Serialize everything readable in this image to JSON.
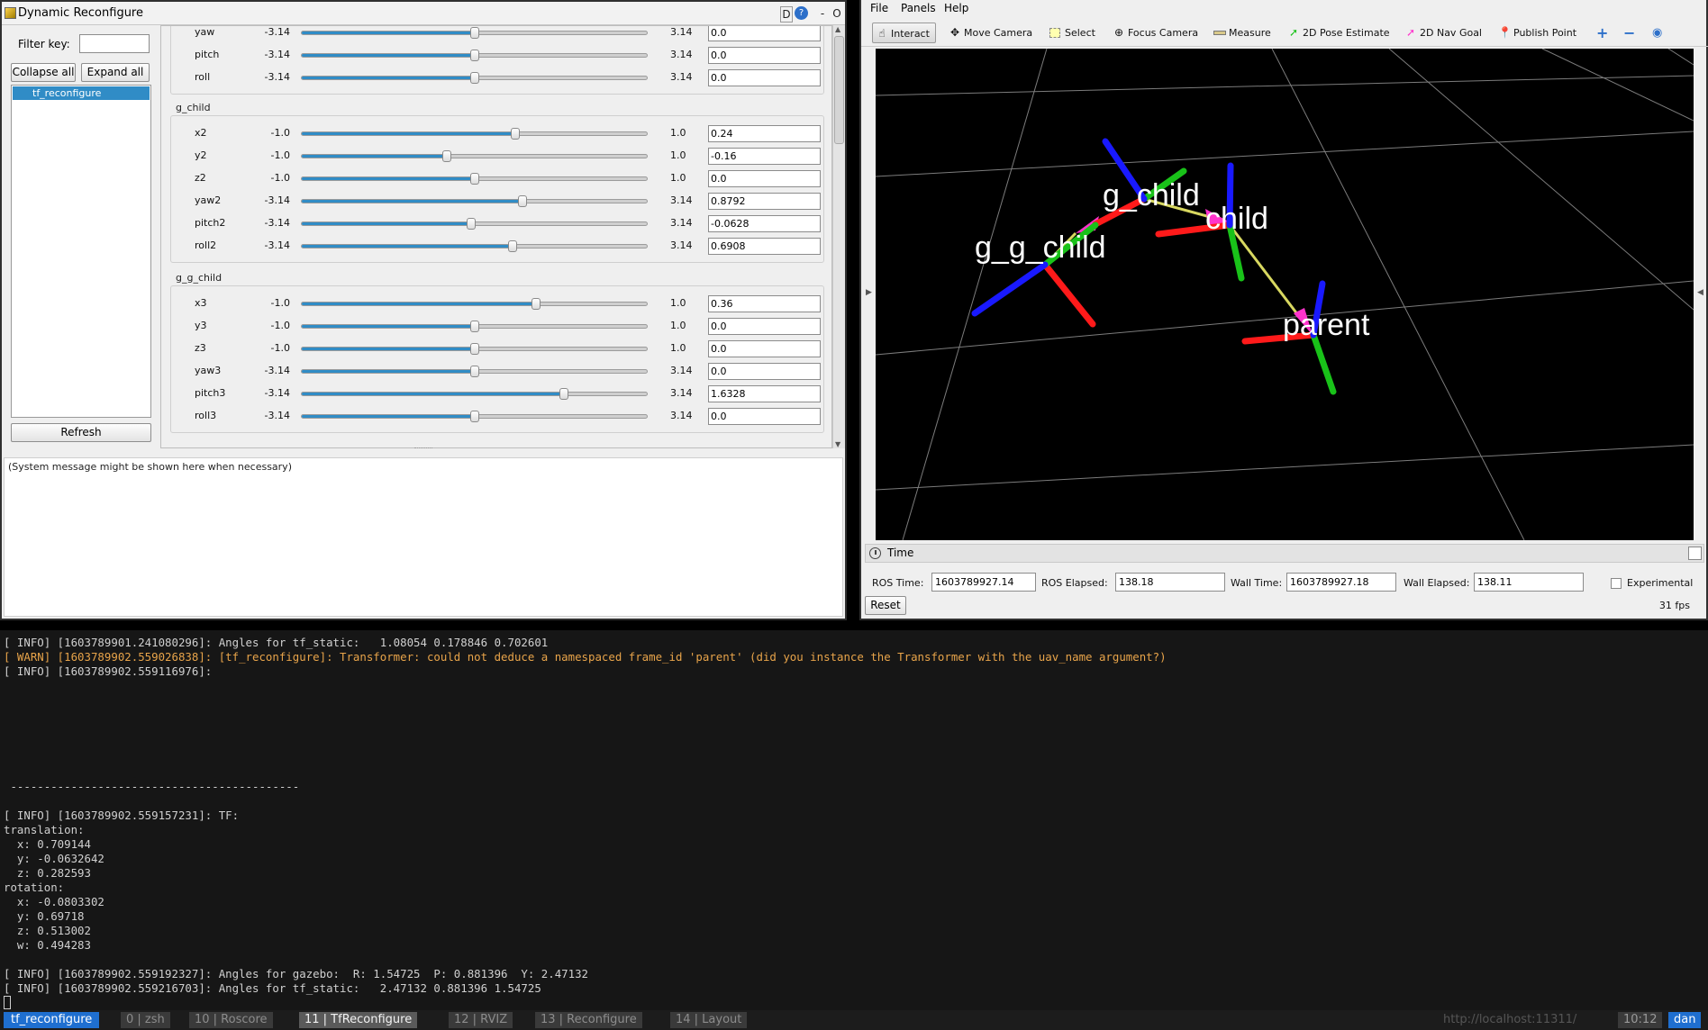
{
  "rqt": {
    "title": "Dynamic Reconfigure",
    "title_buttons": {
      "d": "D",
      "help": "?",
      "minimize": "-",
      "close": "O"
    },
    "filter_label": "Filter key:",
    "filter_value": "",
    "collapse_all": "Collapse all",
    "expand_all": "Expand all",
    "nodes": [
      "tf_reconfigure"
    ],
    "refresh": "Refresh",
    "system_message": "(System message might be shown here when necessary)",
    "groups": [
      {
        "title": "",
        "params": [
          {
            "name": "yaw",
            "min": "-3.14",
            "max": "3.14",
            "value": "0.0",
            "fraction": 0.5
          },
          {
            "name": "pitch",
            "min": "-3.14",
            "max": "3.14",
            "value": "0.0",
            "fraction": 0.5
          },
          {
            "name": "roll",
            "min": "-3.14",
            "max": "3.14",
            "value": "0.0",
            "fraction": 0.5
          }
        ]
      },
      {
        "title": "g_child",
        "params": [
          {
            "name": "x2",
            "min": "-1.0",
            "max": "1.0",
            "value": "0.24",
            "fraction": 0.62
          },
          {
            "name": "y2",
            "min": "-1.0",
            "max": "1.0",
            "value": "-0.16",
            "fraction": 0.42
          },
          {
            "name": "z2",
            "min": "-1.0",
            "max": "1.0",
            "value": "0.0",
            "fraction": 0.5
          },
          {
            "name": "yaw2",
            "min": "-3.14",
            "max": "3.14",
            "value": "0.8792",
            "fraction": 0.64
          },
          {
            "name": "pitch2",
            "min": "-3.14",
            "max": "3.14",
            "value": "-0.0628",
            "fraction": 0.49
          },
          {
            "name": "roll2",
            "min": "-3.14",
            "max": "3.14",
            "value": "0.6908",
            "fraction": 0.61
          }
        ]
      },
      {
        "title": "g_g_child",
        "params": [
          {
            "name": "x3",
            "min": "-1.0",
            "max": "1.0",
            "value": "0.36",
            "fraction": 0.68
          },
          {
            "name": "y3",
            "min": "-1.0",
            "max": "1.0",
            "value": "0.0",
            "fraction": 0.5
          },
          {
            "name": "z3",
            "min": "-1.0",
            "max": "1.0",
            "value": "0.0",
            "fraction": 0.5
          },
          {
            "name": "yaw3",
            "min": "-3.14",
            "max": "3.14",
            "value": "0.0",
            "fraction": 0.5
          },
          {
            "name": "pitch3",
            "min": "-3.14",
            "max": "3.14",
            "value": "1.6328",
            "fraction": 0.76
          },
          {
            "name": "roll3",
            "min": "-3.14",
            "max": "3.14",
            "value": "0.0",
            "fraction": 0.5
          }
        ]
      }
    ]
  },
  "rviz": {
    "menu": [
      "File",
      "Panels",
      "Help"
    ],
    "tools": [
      {
        "label": "Interact",
        "icon": "hand-icon",
        "active": true
      },
      {
        "label": "Move Camera",
        "icon": "move-camera-icon",
        "active": false
      },
      {
        "label": "Select",
        "icon": "select-icon",
        "active": false
      },
      {
        "label": "Focus Camera",
        "icon": "focus-icon",
        "active": false
      },
      {
        "label": "Measure",
        "icon": "ruler-icon",
        "active": false
      },
      {
        "label": "2D Pose Estimate",
        "icon": "pose-arrow-icon",
        "active": false
      },
      {
        "label": "2D Nav Goal",
        "icon": "nav-arrow-icon",
        "active": false
      },
      {
        "label": "Publish Point",
        "icon": "pin-icon",
        "active": false
      }
    ],
    "frames": [
      "g_g_child",
      "g_child",
      "child",
      "parent"
    ],
    "time_panel": {
      "title": "Time",
      "ros_time_label": "ROS Time:",
      "ros_time": "1603789927.14",
      "ros_elapsed_label": "ROS Elapsed:",
      "ros_elapsed": "138.18",
      "wall_time_label": "Wall Time:",
      "wall_time": "1603789927.18",
      "wall_elapsed_label": "Wall Elapsed:",
      "wall_elapsed": "138.11",
      "experimental": "Experimental",
      "reset": "Reset",
      "fps": "31 fps"
    },
    "colors": {
      "x_axis": "#ff1a1a",
      "y_axis": "#19c219",
      "z_axis": "#1919ff",
      "tf_arrow": "#d8d860",
      "arrow_head": "#ff33cc"
    }
  },
  "terminal": {
    "lines": [
      {
        "text": "[ INFO] [1603789901.241080296]: Angles for tf_static:   1.08054 0.178846 0.702601",
        "level": "info"
      },
      {
        "text": "[ WARN] [1603789902.559026838]: [tf_reconfigure]: Transformer: could not deduce a namespaced frame_id 'parent' (did you instance the Transformer with the uav_name argument?)",
        "level": "warn"
      },
      {
        "text": "[ INFO] [1603789902.559116976]:",
        "level": "info"
      },
      {
        "text": " -------------------------------------------",
        "level": "info"
      },
      {
        "text": "[ INFO] [1603789902.559157231]: TF:",
        "level": "info"
      },
      {
        "text": "translation:",
        "level": "info"
      },
      {
        "text": "  x: 0.709144",
        "level": "info"
      },
      {
        "text": "  y: -0.0632642",
        "level": "info"
      },
      {
        "text": "  z: 0.282593",
        "level": "info"
      },
      {
        "text": "rotation:",
        "level": "info"
      },
      {
        "text": "  x: -0.0803302",
        "level": "info"
      },
      {
        "text": "  y: 0.69718",
        "level": "info"
      },
      {
        "text": "  z: 0.513002",
        "level": "info"
      },
      {
        "text": "  w: 0.494283",
        "level": "info"
      },
      {
        "text": "[ INFO] [1603789902.559192327]: Angles for gazebo:  R: 1.54725  P: 0.881396  Y: 2.47132",
        "level": "info"
      },
      {
        "text": "[ INFO] [1603789902.559216703]: Angles for tf_static:   2.47132 0.881396 1.54725",
        "level": "info"
      }
    ]
  },
  "statusbar": {
    "session": "tf_reconfigure",
    "windows": [
      {
        "label": "0 | zsh",
        "active": false
      },
      {
        "label": "10 | Roscore",
        "active": false
      },
      {
        "label": "11 | TfReconfigure",
        "active": true
      },
      {
        "label": "12 | RVIZ",
        "active": false
      },
      {
        "label": "13 | Reconfigure",
        "active": false
      },
      {
        "label": "14 | Layout",
        "active": false
      }
    ],
    "url": "http://localhost:11311/",
    "time": "10:12",
    "user": "dan"
  }
}
